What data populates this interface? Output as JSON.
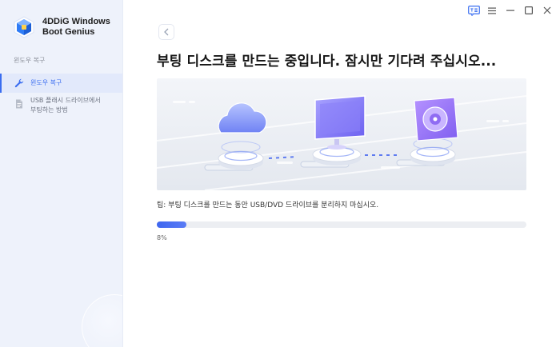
{
  "app": {
    "name": "4DDiG Windows Boot Genius",
    "name_line1": "4DDiG Windows",
    "name_line2": "Boot Genius"
  },
  "sidebar": {
    "section_label": "윈도우 복구",
    "items": [
      {
        "label": "윈도우 복구",
        "icon": "wrench-icon",
        "active": true
      },
      {
        "label_line1": "USB 플래시 드라이브에서",
        "label_line2": "부팅하는 방법",
        "icon": "document-icon",
        "active": false
      }
    ]
  },
  "window_controls": [
    "feedback-icon",
    "menu-icon",
    "minimize-icon",
    "maximize-icon",
    "close-icon"
  ],
  "main": {
    "title": "부팅 디스크를 만드는 중입니다. 잠시만 기다려 주십시오...",
    "tip": "팁: 부팅 디스크를 만드는 동안 USB/DVD 드라이브를 분리하지 마십시오.",
    "progress_value": 8,
    "progress_label": "8%"
  },
  "colors": {
    "accent": "#3a6df0",
    "sidebar_bg": "#eef2fb",
    "progress_track": "#eceef2"
  }
}
